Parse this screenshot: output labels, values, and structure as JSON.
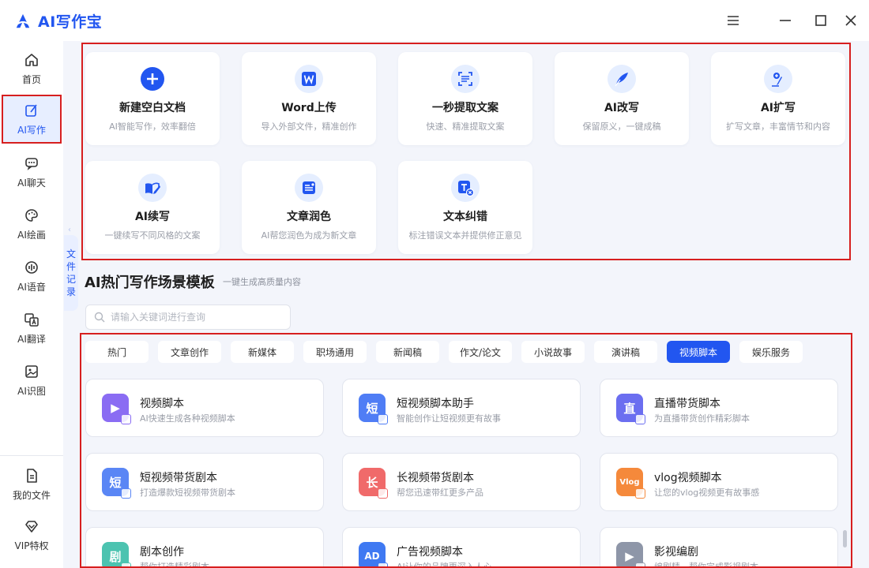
{
  "app": {
    "title": "AI写作宝",
    "brand_color": "#2256f0"
  },
  "window_controls": [
    {
      "name": "menu-button",
      "icon": "menu-icon"
    },
    {
      "name": "minimize-button",
      "icon": "minimize-icon"
    },
    {
      "name": "maximize-button",
      "icon": "maximize-icon"
    },
    {
      "name": "close-button",
      "icon": "close-icon"
    }
  ],
  "sidebar": {
    "items": [
      {
        "label": "首页",
        "icon": "home-icon",
        "active": false
      },
      {
        "label": "AI写作",
        "icon": "write-icon",
        "active": true
      },
      {
        "label": "AI聊天",
        "icon": "chat-icon",
        "active": false
      },
      {
        "label": "AI绘画",
        "icon": "palette-icon",
        "active": false
      },
      {
        "label": "AI语音",
        "icon": "voice-icon",
        "active": false
      },
      {
        "label": "AI翻译",
        "icon": "translate-icon",
        "active": false
      },
      {
        "label": "AI识图",
        "icon": "image-recognition-icon",
        "active": false
      }
    ],
    "bottom": [
      {
        "label": "我的文件",
        "icon": "file-icon"
      },
      {
        "label": "VIP特权",
        "icon": "vip-diamond-icon"
      }
    ]
  },
  "file_record_tab": {
    "chars": [
      "文",
      "件",
      "记",
      "录"
    ]
  },
  "tools": [
    {
      "title": "新建空白文档",
      "desc": "AI智能写作，效率翻倍",
      "icon": "plus-icon"
    },
    {
      "title": "Word上传",
      "desc": "导入外部文件，精准创作",
      "icon": "word-icon"
    },
    {
      "title": "一秒提取文案",
      "desc": "快速、精准提取文案",
      "icon": "extract-icon"
    },
    {
      "title": "AI改写",
      "desc": "保留原义，一键成稿",
      "icon": "rewrite-icon"
    },
    {
      "title": "AI扩写",
      "desc": "扩写文章，丰富情节和内容",
      "icon": "expand-icon"
    },
    {
      "title": "AI续写",
      "desc": "一键续写不同风格的文案",
      "icon": "continue-icon"
    },
    {
      "title": "文章润色",
      "desc": "AI帮您润色为成为新文章",
      "icon": "polish-icon"
    },
    {
      "title": "文本纠错",
      "desc": "标注错误文本并提供修正意见",
      "icon": "correct-icon"
    }
  ],
  "section": {
    "title": "AI热门写作场景模板",
    "subtitle": "一键生成高质量内容",
    "search_placeholder": "请输入关键词进行查询"
  },
  "categories": [
    {
      "label": "热门",
      "active": false
    },
    {
      "label": "文章创作",
      "active": false
    },
    {
      "label": "新媒体",
      "active": false
    },
    {
      "label": "职场通用",
      "active": false
    },
    {
      "label": "新闻稿",
      "active": false
    },
    {
      "label": "作文/论文",
      "active": false
    },
    {
      "label": "小说故事",
      "active": false
    },
    {
      "label": "演讲稿",
      "active": false
    },
    {
      "label": "视频脚本",
      "active": true
    },
    {
      "label": "娱乐服务",
      "active": false
    }
  ],
  "templates": [
    {
      "title": "视频脚本",
      "desc": "AI快速生成各种视频脚本",
      "icon": "video-script-icon",
      "glyph": "▶",
      "color": "#8a6cf3"
    },
    {
      "title": "短视频脚本助手",
      "desc": "智能创作让短视频更有故事",
      "icon": "short-video-icon",
      "glyph": "短",
      "color": "#4f7df5"
    },
    {
      "title": "直播带货脚本",
      "desc": "为直播带货创作精彩脚本",
      "icon": "livestream-icon",
      "glyph": "直",
      "color": "#6b6ef0"
    },
    {
      "title": "短视频带货剧本",
      "desc": "打造爆款短视频带货剧本",
      "icon": "short-video-sales-icon",
      "glyph": "短",
      "color": "#5a86f5"
    },
    {
      "title": "长视频带货剧本",
      "desc": "帮您迅速带红更多产品",
      "icon": "long-video-sales-icon",
      "glyph": "长",
      "color": "#f06a6a"
    },
    {
      "title": "vlog视频脚本",
      "desc": "让您的vlog视频更有故事感",
      "icon": "vlog-icon",
      "glyph": "Vlog",
      "color": "#f5893b"
    },
    {
      "title": "剧本创作",
      "desc": "帮你打造精彩剧本",
      "icon": "script-icon",
      "glyph": "剧",
      "color": "#4cc3b0"
    },
    {
      "title": "广告视频脚本",
      "desc": "AI让你的品牌更深入人心",
      "icon": "ad-video-icon",
      "glyph": "AD",
      "color": "#3f79f2"
    },
    {
      "title": "影视编剧",
      "desc": "编剧精，帮你完成影视剧本",
      "icon": "film-icon",
      "glyph": "▶",
      "color": "#8e96a8"
    }
  ]
}
